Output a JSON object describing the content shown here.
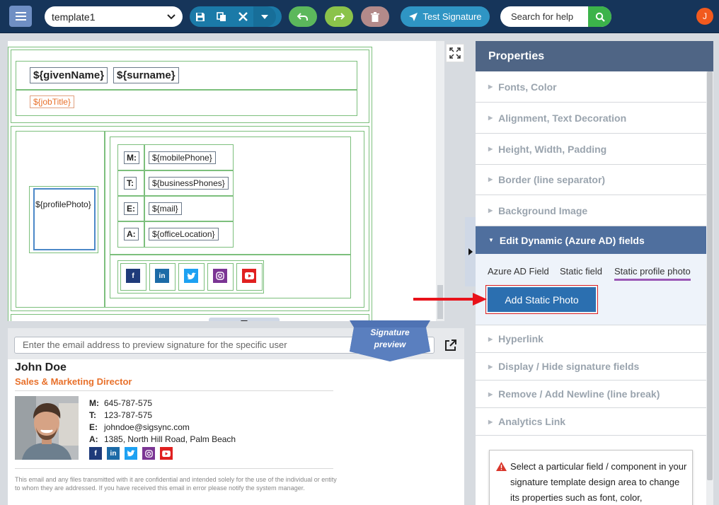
{
  "toolbar": {
    "template_value": "template1",
    "test_signature_label": "Test Signature",
    "search_placeholder": "Search for help",
    "avatar_initial": "J"
  },
  "canvas": {
    "given_name": "${givenName}",
    "surname": "${surname}",
    "job_title": "${jobTitle}",
    "profile_photo": "${profilePhoto}",
    "contact_rows": [
      {
        "label": "M:",
        "value": "${mobilePhone}"
      },
      {
        "label": "T:",
        "value": "${businessPhones}"
      },
      {
        "label": "E:",
        "value": "${mail}"
      },
      {
        "label": "A:",
        "value": "${officeLocation}"
      }
    ],
    "social": [
      {
        "icon": "facebook-icon",
        "glyph": "f",
        "color": "#1f3b7a"
      },
      {
        "icon": "linkedin-icon",
        "glyph": "in",
        "color": "#1c6ba7"
      },
      {
        "icon": "twitter-icon",
        "glyph": "🐦",
        "color": "#1da1f2"
      },
      {
        "icon": "instagram-icon",
        "glyph": "◎",
        "color": "#7b3594"
      },
      {
        "icon": "youtube-icon",
        "glyph": "▶",
        "color": "#e02020"
      }
    ]
  },
  "preview": {
    "email_placeholder": "Enter the email address to preview signature for the specific user",
    "tab_line1": "Signature",
    "tab_line2": "preview",
    "name": "John Doe",
    "title": "Sales & Marketing Director",
    "rows": [
      {
        "label": "M:",
        "value": "645-787-575"
      },
      {
        "label": "T:",
        "value": "123-787-575"
      },
      {
        "label": "E:",
        "value": "johndoe@sigsync.com"
      },
      {
        "label": "A:",
        "value": "1385, North Hill Road, Palm Beach"
      }
    ],
    "disclaimer": "This email and any files transmitted with it are confidential and intended solely for the use of the individual or entity to whom they are addressed. If you have received this email in error please notify the system manager."
  },
  "properties": {
    "title": "Properties",
    "sections": [
      "Fonts, Color",
      "Alignment, Text Decoration",
      "Height, Width, Padding",
      "Border (line separator)",
      "Background Image",
      "Edit Dynamic (Azure AD) fields",
      "Hyperlink",
      "Display / Hide signature fields",
      "Remove / Add Newline (line break)",
      "Analytics Link"
    ],
    "sub_tabs": [
      "Azure AD Field",
      "Static field",
      "Static profile photo"
    ],
    "add_static_photo": "Add Static Photo",
    "info_text": "Select a particular field / component in your signature template design area to change its properties such as font, color,"
  },
  "colors": {
    "topbar": "#16355a",
    "accent_orange": "#e8702a",
    "panel_header": "#4f6585",
    "open_section": "#4f6f9e",
    "primary_button": "#2b6fb0",
    "highlight_red": "#e02020"
  }
}
